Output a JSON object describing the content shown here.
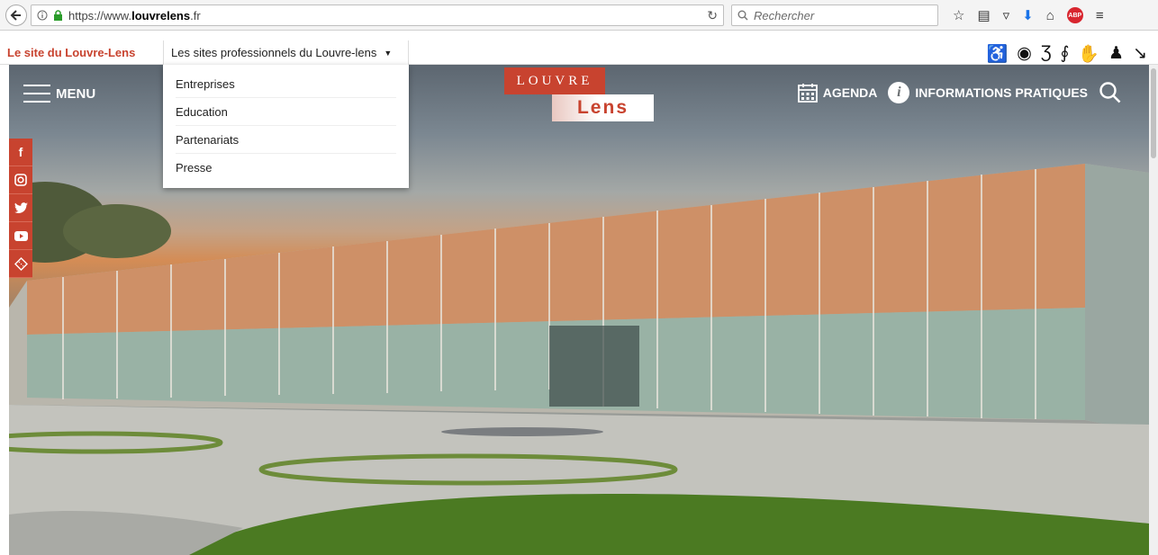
{
  "browser": {
    "url_prefix": "https://www.",
    "url_host": "louvrelens",
    "url_suffix": ".fr",
    "search_placeholder": "Rechercher",
    "toolbar_icons": [
      "star-icon",
      "reading-list-icon",
      "pocket-icon",
      "download-icon",
      "home-icon",
      "adblock-icon",
      "menu-icon"
    ],
    "abp_label": "ABP"
  },
  "pro_bar": {
    "site_link": "Le site du Louvre-Lens",
    "pro_sites_label": "Les sites professionnels du Louvre-lens",
    "accessibility_icons": [
      "wheelchair-icon",
      "low-vision-icon",
      "deaf-icon",
      "hearing-icon",
      "sign-language-icon",
      "family-icon",
      "stroller-icon"
    ]
  },
  "dropdown": {
    "items": [
      "Entreprises",
      "Education",
      "Partenariats",
      "Presse"
    ]
  },
  "hero": {
    "menu_label": "MENU",
    "logo_top": "LOUVRE",
    "logo_bottom": "Lens",
    "agenda_label": "AGENDA",
    "info_label": "INFORMATIONS PRATIQUES",
    "social": [
      "facebook-icon",
      "instagram-icon",
      "twitter-icon",
      "youtube-icon",
      "ticket-icon"
    ]
  },
  "colors": {
    "brand_red": "#c8432f",
    "sky_top": "#5c6670",
    "sunset": "#d48c55"
  }
}
